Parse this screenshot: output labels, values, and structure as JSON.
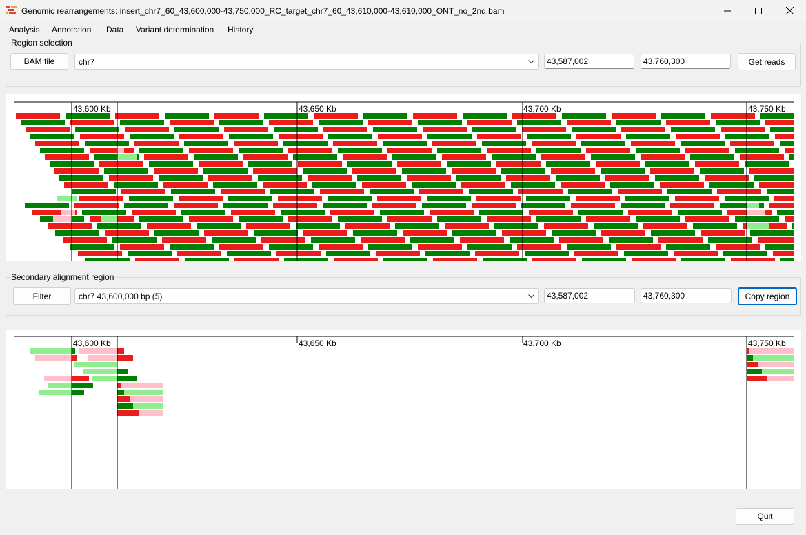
{
  "window": {
    "title": "Genomic rearrangements: insert_chr7_60_43,600,000-43,750,000_RC_target_chr7_60_43,610,000-43,610,000_ONT_no_2nd.bam"
  },
  "menu": [
    "Analysis",
    "Annotation",
    "Data",
    "Variant determination",
    "History"
  ],
  "region_selection": {
    "label": "Region selection",
    "bam_button": "BAM file",
    "chromosome": "chr7",
    "start": "43,587,002",
    "end": "43,760,300",
    "get_reads_button": "Get reads"
  },
  "secondary_region": {
    "label": "Secondary alignment region",
    "filter_button": "Filter",
    "selected_region": "chr7 43,600,000 bp (5)",
    "start": "43,587,002",
    "end": "43,760,300",
    "copy_button": "Copy region"
  },
  "colors": {
    "forward": "#008000",
    "reverse": "#ec1c1c",
    "forward_secondary": "#90ee90",
    "reverse_secondary": "#ffc0cb"
  },
  "ruler_ticks": [
    "43,600 Kb",
    "43,650 Kb",
    "43,700 Kb",
    "43,750 Kb"
  ],
  "breakpoint_lines": [
    "43,600,000",
    "43,610,000",
    "43,750,000"
  ],
  "quit_button": "Quit"
}
